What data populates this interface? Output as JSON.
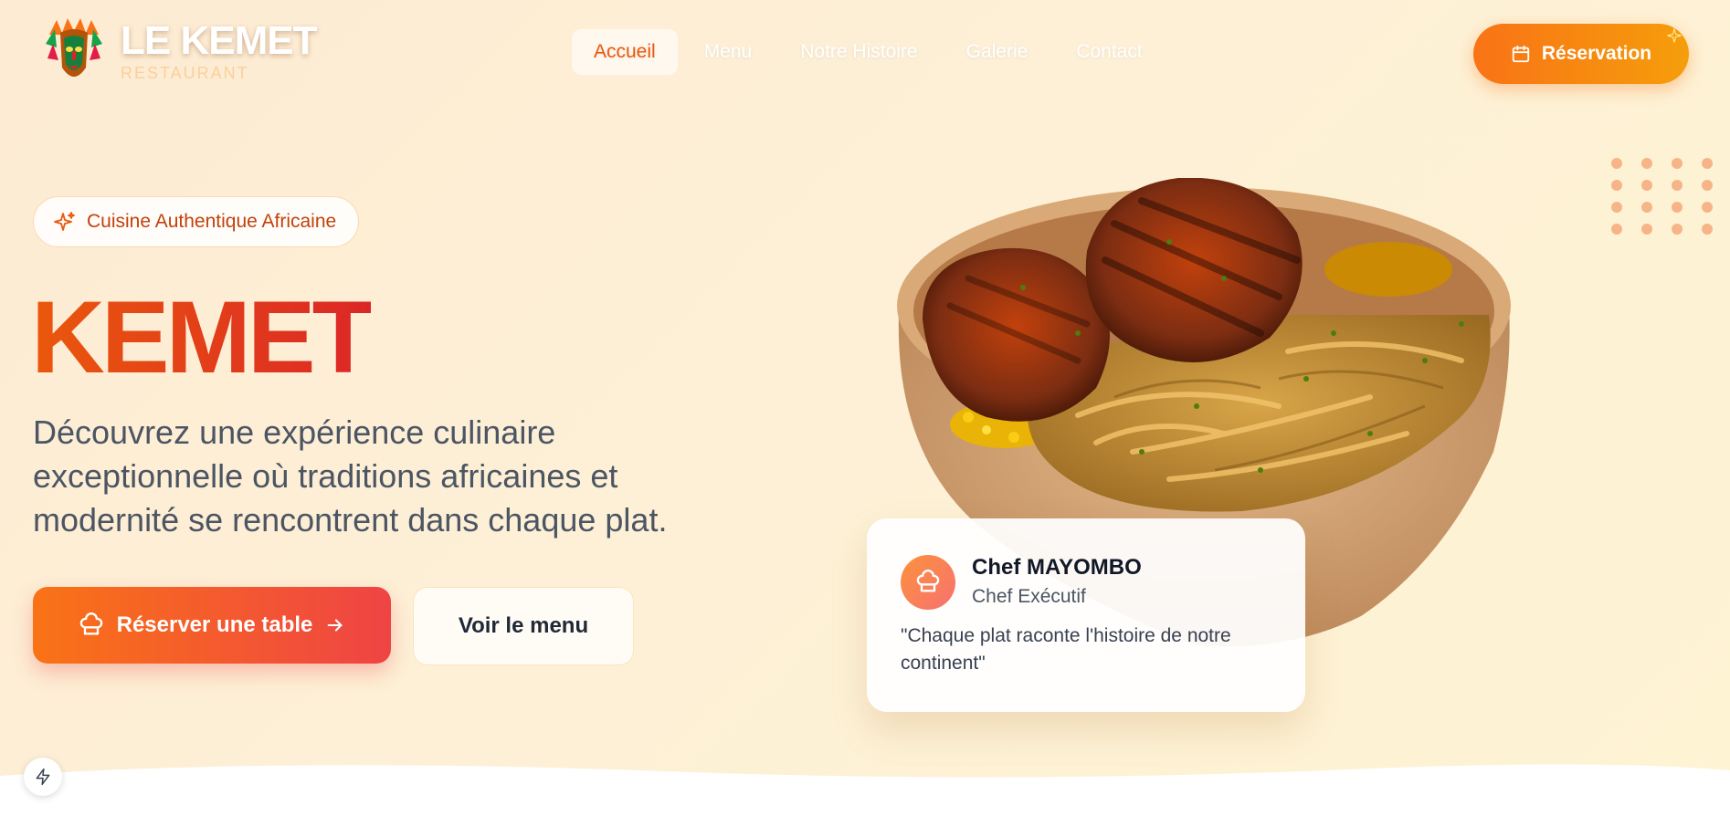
{
  "brand": {
    "title": "LE KEMET",
    "subtitle": "RESTAURANT"
  },
  "nav": {
    "items": [
      {
        "label": "Accueil",
        "active": true
      },
      {
        "label": "Menu",
        "active": false
      },
      {
        "label": "Notre Histoire",
        "active": false
      },
      {
        "label": "Galerie",
        "active": false
      },
      {
        "label": "Contact",
        "active": false
      }
    ],
    "reservation_label": "Réservation"
  },
  "hero": {
    "badge": "Cuisine Authentique Africaine",
    "title": "KEMET",
    "description": "Découvrez une expérience culinaire exceptionnelle où traditions africaines et modernité se rencontrent dans chaque plat.",
    "primary_button": "Réserver une table",
    "secondary_button": "Voir le menu"
  },
  "chef": {
    "name": "Chef MAYOMBO",
    "role": "Chef Exécutif",
    "quote": "\"Chaque plat raconte l'histoire de notre continent\""
  },
  "colors": {
    "accent": "#f97316",
    "accent_red": "#ef4444",
    "badge_text": "#c2410c",
    "background": "#fdefd6"
  },
  "icons": {
    "reservation": "calendar-icon",
    "badge": "sparkles-icon",
    "primary_button": "chef-hat-icon",
    "arrow": "arrow-right-icon",
    "floating": "bolt-icon"
  }
}
